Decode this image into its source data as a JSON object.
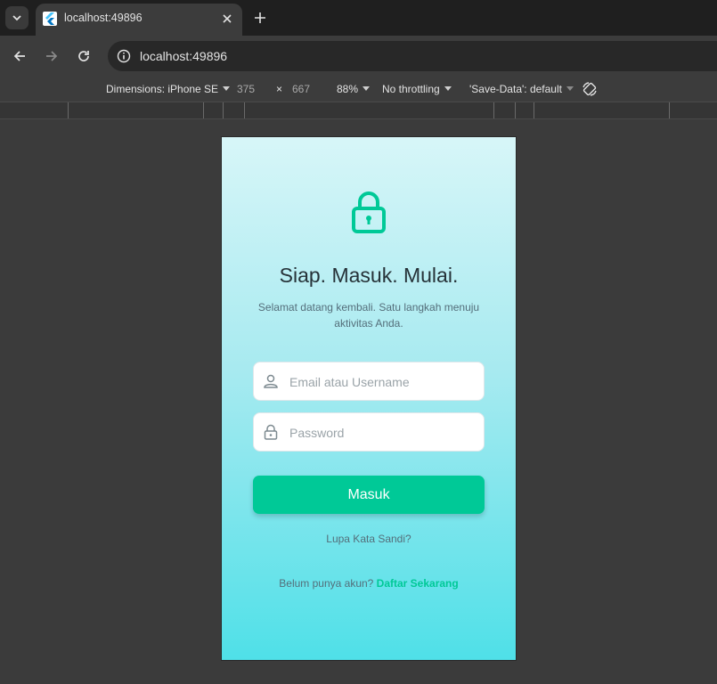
{
  "browser": {
    "tab_title": "localhost:49896",
    "url": "localhost:49896",
    "icons": [
      "tab-search-icon",
      "flutter-icon",
      "close-icon",
      "plus-icon",
      "back-icon",
      "forward-icon",
      "reload-icon",
      "info-icon"
    ]
  },
  "devtools": {
    "dimensions_label": "Dimensions: iPhone SE",
    "width": "375",
    "times": "×",
    "height": "667",
    "zoom": "88%",
    "throttling": "No throttling",
    "save_data": "'Save-Data': default"
  },
  "app": {
    "headline": "Siap. Masuk. Mulai.",
    "subtitle": "Selamat datang kembali. Satu langkah menuju aktivitas Anda.",
    "email_placeholder": "Email atau Username",
    "email_value": "",
    "password_placeholder": "Password",
    "password_value": "",
    "login_label": "Masuk",
    "forgot_label": "Lupa Kata Sandi?",
    "signup_prompt": "Belum punya akun? ",
    "signup_link": "Daftar Sekarang",
    "colors": {
      "accent": "#00c997",
      "headline": "#263238",
      "gradient_top": "#d7f6f8",
      "gradient_bottom": "#4fe0e8"
    }
  }
}
